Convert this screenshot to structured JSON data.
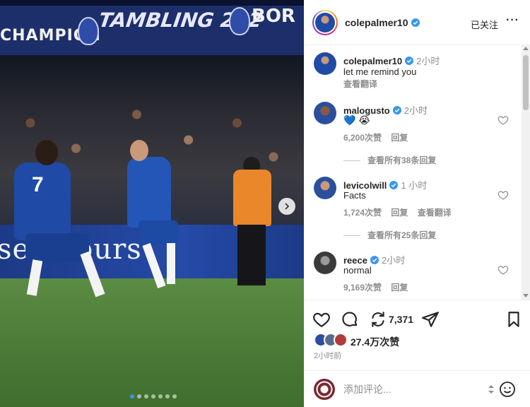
{
  "photo": {
    "banner_left": "CHAMPION",
    "banner_mid": "TAMBLING 202",
    "banner_right": "BOR",
    "ad_text": "seu  Tours",
    "shirt_number": "7",
    "carousel_count": 7,
    "carousel_active": 0
  },
  "header": {
    "username": "colepalmer10",
    "follow_status": "已关注",
    "more": "···"
  },
  "caption": {
    "username": "colepalmer10",
    "time": "2小时",
    "text": "let me remind you",
    "translate": "查看翻译"
  },
  "comments": [
    {
      "username": "malogusto",
      "time": "2小时",
      "text": "💙 😭",
      "likes": "6,200次赞",
      "reply": "回复",
      "translate": "",
      "view_replies": "查看所有38条回复"
    },
    {
      "username": "levicolwill",
      "time": "1 小时",
      "text": "Facts",
      "likes": "1,724次赞",
      "reply": "回复",
      "translate": "查看翻译",
      "view_replies": "查看所有25条回复"
    },
    {
      "username": "reece",
      "time": "2小时",
      "text": "normal",
      "likes": "9,169次赞",
      "reply": "回复",
      "translate": "",
      "view_replies": ""
    }
  ],
  "actions": {
    "share_count": "7,371",
    "likes": "27.4万次赞",
    "post_time": "2小时前"
  },
  "add_comment": {
    "placeholder": "添加评论..."
  },
  "colors": {
    "verified": "#3897f0",
    "text": "#262626",
    "muted": "#8e8e8e"
  }
}
